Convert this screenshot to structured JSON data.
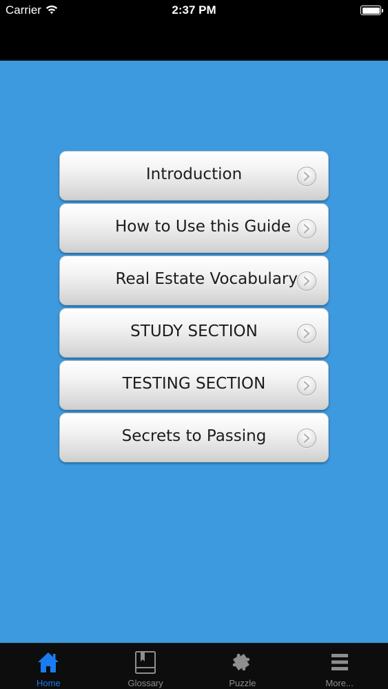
{
  "status_bar": {
    "carrier": "Carrier",
    "time": "2:37 PM"
  },
  "menu": {
    "items": [
      {
        "label": "Introduction",
        "align": "center"
      },
      {
        "label": "How to Use this Guide",
        "align": "right"
      },
      {
        "label": "Real Estate Vocabulary",
        "align": "rightmost"
      },
      {
        "label": "STUDY SECTION",
        "align": "center"
      },
      {
        "label": "TESTING SECTION",
        "align": "center"
      },
      {
        "label": "Secrets to Passing",
        "align": "center"
      }
    ]
  },
  "tab_bar": {
    "tabs": [
      {
        "label": "Home",
        "icon": "home-icon",
        "active": true
      },
      {
        "label": "Glossary",
        "icon": "book-icon",
        "active": false
      },
      {
        "label": "Puzzle",
        "icon": "puzzle-icon",
        "active": false
      },
      {
        "label": "More...",
        "icon": "more-icon",
        "active": false
      }
    ]
  },
  "colors": {
    "background": "#3d9ade",
    "tab_active": "#1a7cf0",
    "tab_inactive": "#8e8e8e"
  }
}
